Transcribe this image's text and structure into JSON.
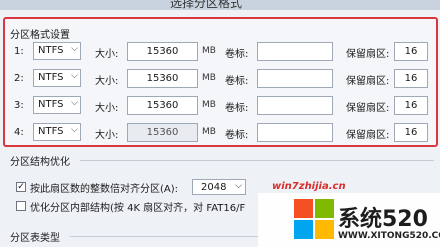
{
  "title": "选择分区格式",
  "format_section": {
    "label": "分区格式设置"
  },
  "rows": [
    {
      "num": "1:",
      "fs": "NTFS",
      "size_label": "大小:",
      "size": "15360",
      "unit": "MB",
      "vol_label": "卷标:",
      "vol": "",
      "reserve_label": "保留扇区:",
      "reserve": "16",
      "enabled": true
    },
    {
      "num": "2:",
      "fs": "NTFS",
      "size_label": "大小:",
      "size": "15360",
      "unit": "MB",
      "vol_label": "卷标:",
      "vol": "",
      "reserve_label": "保留扇区:",
      "reserve": "16",
      "enabled": true
    },
    {
      "num": "3:",
      "fs": "NTFS",
      "size_label": "大小:",
      "size": "15360",
      "unit": "MB",
      "vol_label": "卷标:",
      "vol": "",
      "reserve_label": "保留扇区:",
      "reserve": "16",
      "enabled": true
    },
    {
      "num": "4:",
      "fs": "NTFS",
      "size_label": "大小:",
      "size": "15360",
      "unit": "MB",
      "vol_label": "卷标:",
      "vol": "",
      "reserve_label": "保留扇区:",
      "reserve": "16",
      "enabled": false
    }
  ],
  "optimize_section": {
    "label": "分区结构优化",
    "align_label": "按此扇区数的整数倍对齐分区(A):",
    "align_checked": true,
    "align_value": "2048",
    "inner_label": "优化分区内部结构(按 4K 扇区对齐，对 FAT16/F",
    "inner_checked": false
  },
  "table_section": {
    "label": "分区表类型"
  },
  "watermark": {
    "site": "win7zhijia.cn",
    "brand": "系统520",
    "url": "WWW.XITONG520.COM"
  },
  "colors": {
    "frame_red": "#d9363e",
    "logo_red": "#f25022",
    "logo_green": "#7fba00",
    "logo_blue": "#00a4ef",
    "logo_yellow": "#ffb900"
  }
}
